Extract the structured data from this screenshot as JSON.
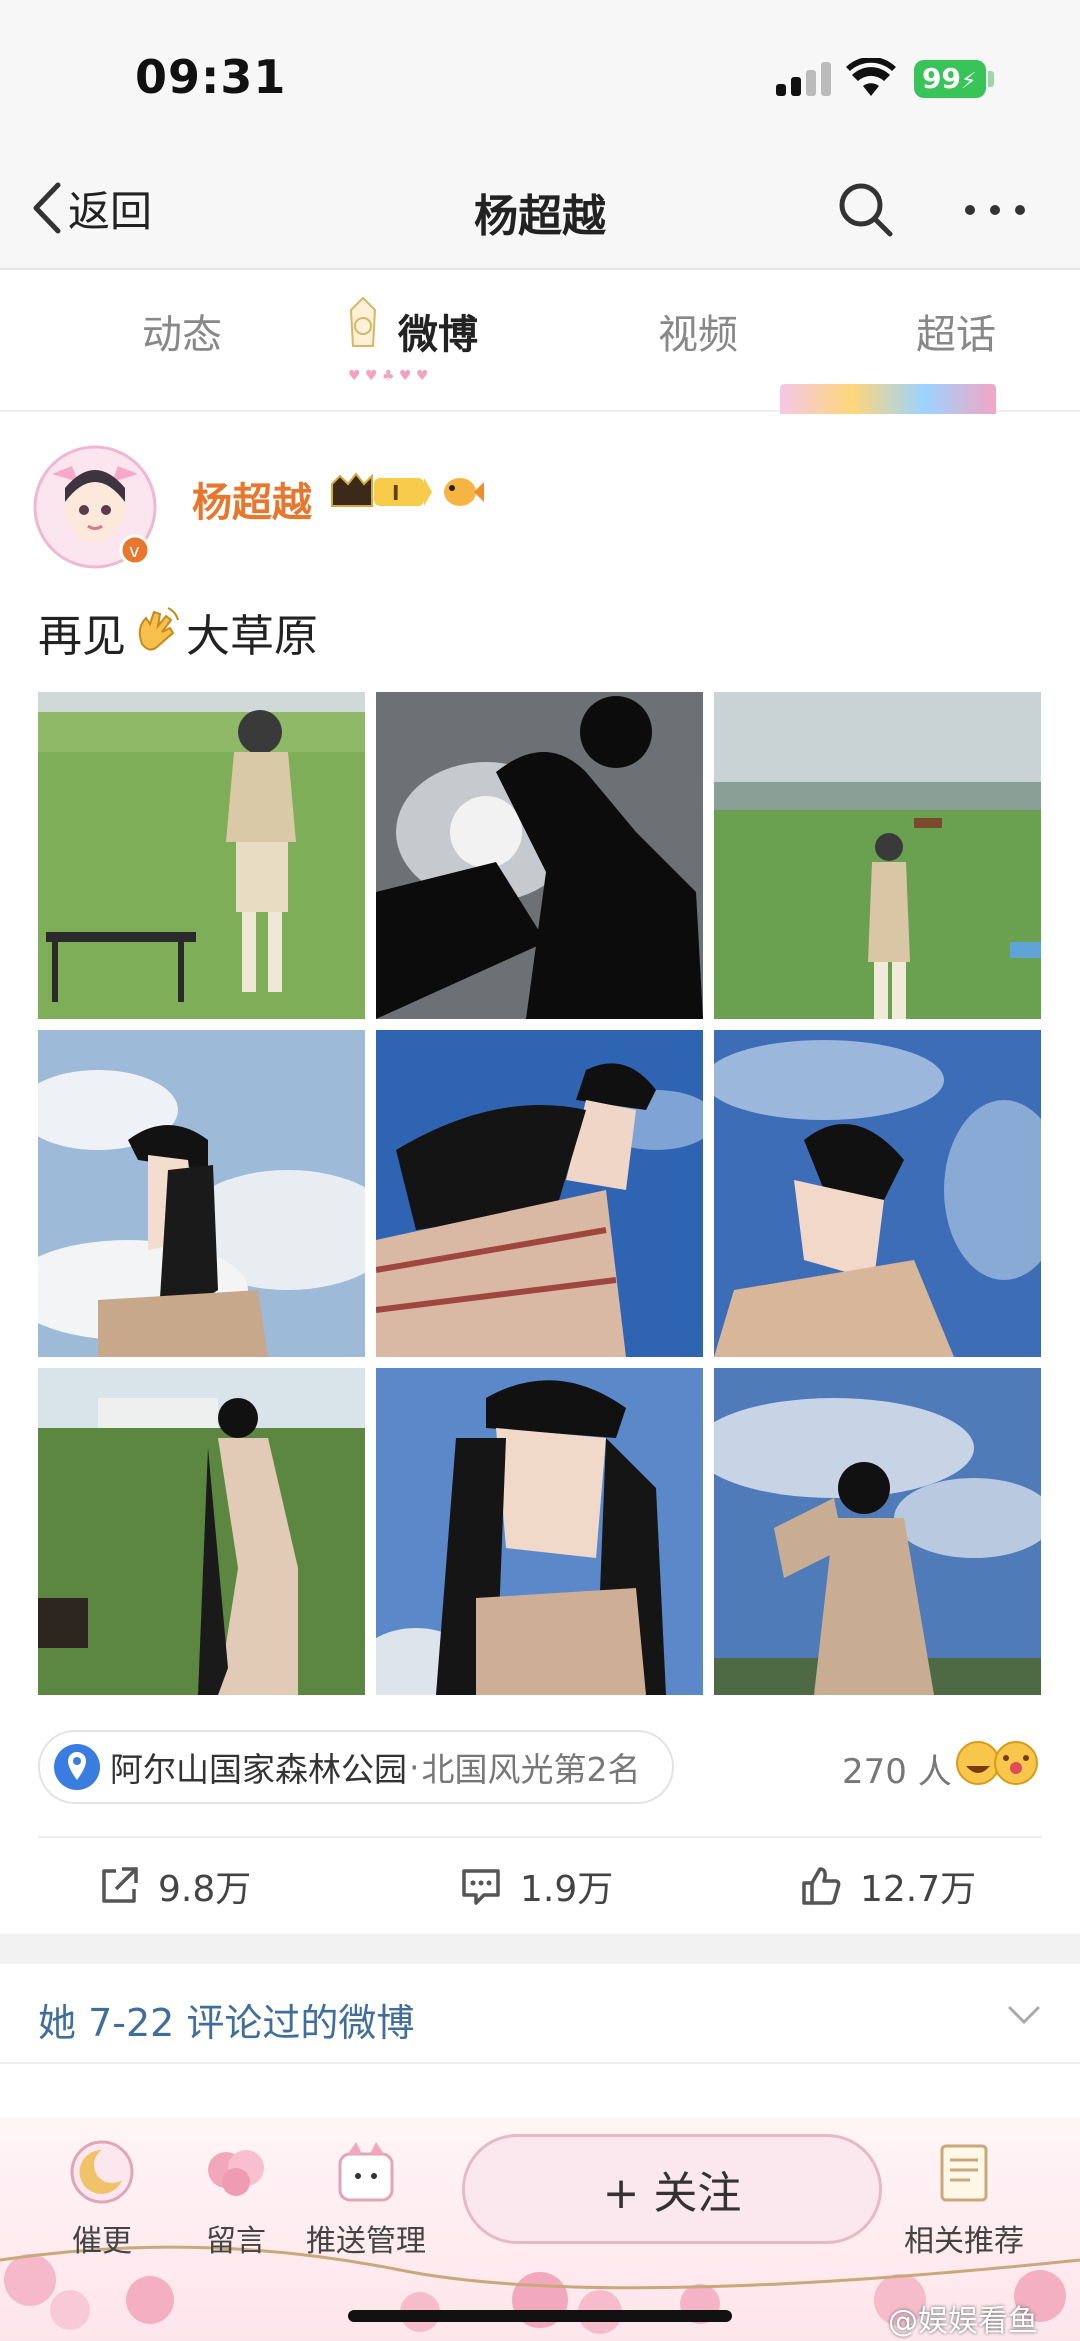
{
  "status_bar": {
    "time": "09:31",
    "battery": "99"
  },
  "nav": {
    "back_label": "返回",
    "title": "杨超越"
  },
  "tabs": [
    {
      "label": "动态",
      "active": false
    },
    {
      "label": "微博",
      "active": true
    },
    {
      "label": "视频",
      "active": false
    },
    {
      "label": "超话",
      "active": false
    }
  ],
  "post": {
    "author": "杨超越",
    "vip_level": "I",
    "text_before": "再见",
    "text_emoji": "waving-hand-icon",
    "text_after": "大草原",
    "photo_count": 9,
    "location": {
      "name": "阿尔山国家森林公园",
      "separator": "·",
      "rank": "北国风光第2名"
    },
    "visitors": "270 人",
    "actions": {
      "share": "9.8万",
      "comment": "1.9万",
      "like": "12.7万"
    }
  },
  "commented_section": {
    "label": "她 7-22 评论过的微博"
  },
  "bottom_bar": {
    "items": [
      {
        "label": "催更",
        "icon": "update-reminder-icon"
      },
      {
        "label": "留言",
        "icon": "message-icon"
      },
      {
        "label": "推送管理",
        "icon": "push-settings-icon"
      },
      {
        "label": "相关推荐",
        "icon": "recommend-icon"
      }
    ],
    "follow_label": "+ 关注"
  },
  "watermark": "@娱娱看鱼",
  "colors": {
    "author": "#e8762c",
    "link": "#3f6e9e",
    "battery": "#39c45a"
  }
}
